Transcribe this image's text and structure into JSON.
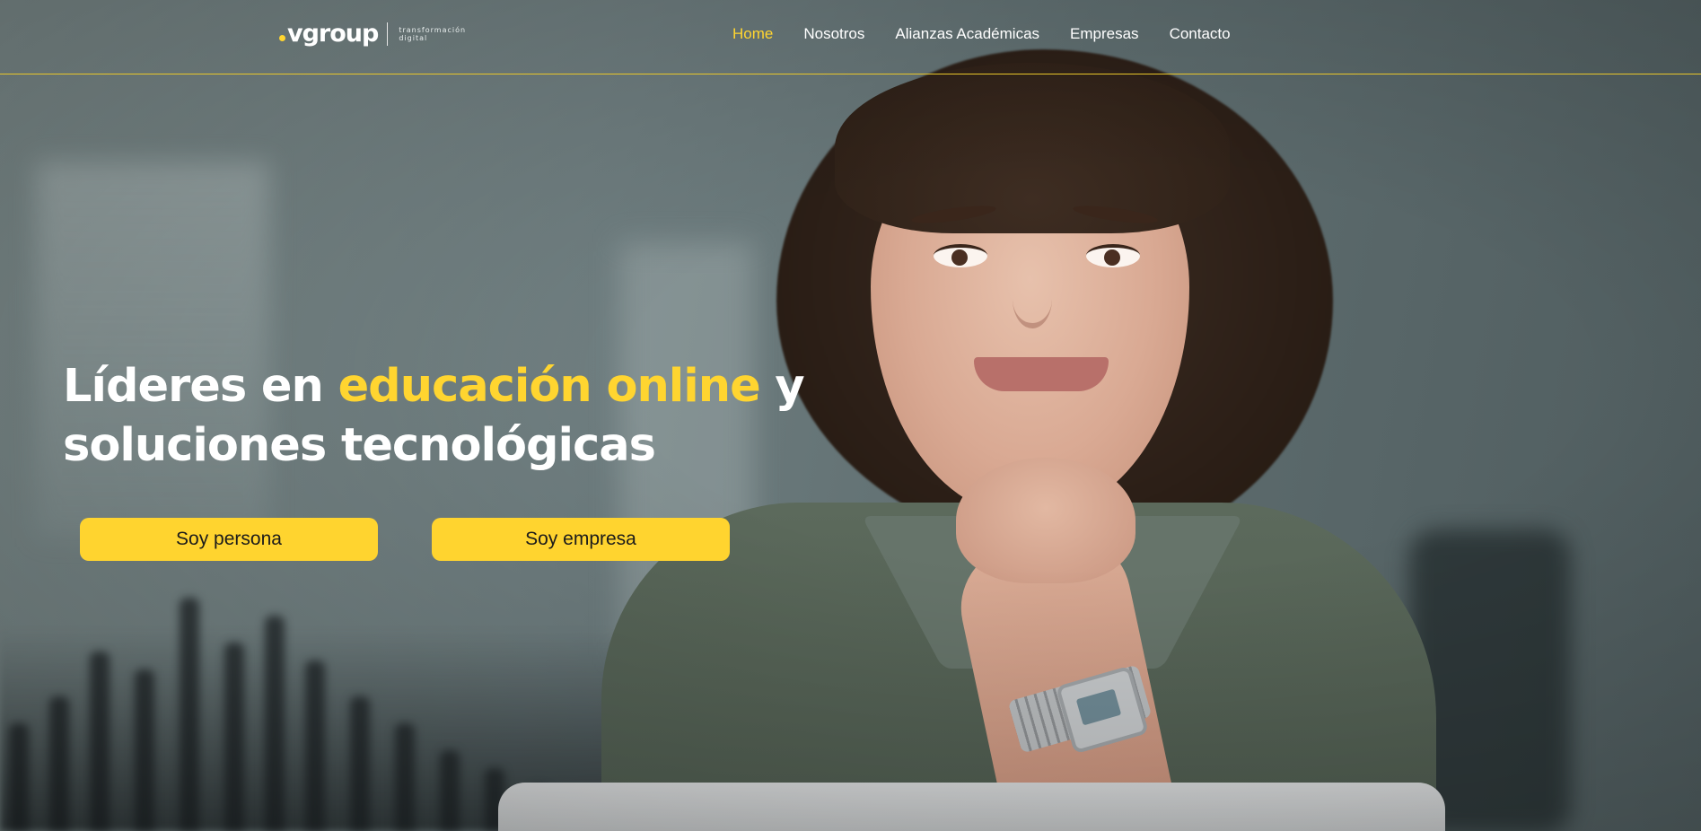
{
  "brand": {
    "logo_text": "vgroup",
    "tagline_line1": "transformación",
    "tagline_line2": "digital",
    "accent_color": "#ffd530"
  },
  "nav": {
    "items": [
      {
        "label": "Home",
        "active": true
      },
      {
        "label": "Nosotros",
        "active": false
      },
      {
        "label": "Alianzas Académicas",
        "active": false
      },
      {
        "label": "Empresas",
        "active": false
      },
      {
        "label": "Contacto",
        "active": false
      }
    ]
  },
  "hero": {
    "title_part1": "Líderes en ",
    "title_highlight": "educación online",
    "title_part2": " y",
    "title_line2": "soluciones tecnológicas",
    "buttons": {
      "persona": "Soy persona",
      "empresa": "Soy empresa"
    }
  },
  "colors": {
    "button_bg": "#ffd42f",
    "header_rule": "#e8c62a",
    "text_primary": "#ffffff"
  }
}
